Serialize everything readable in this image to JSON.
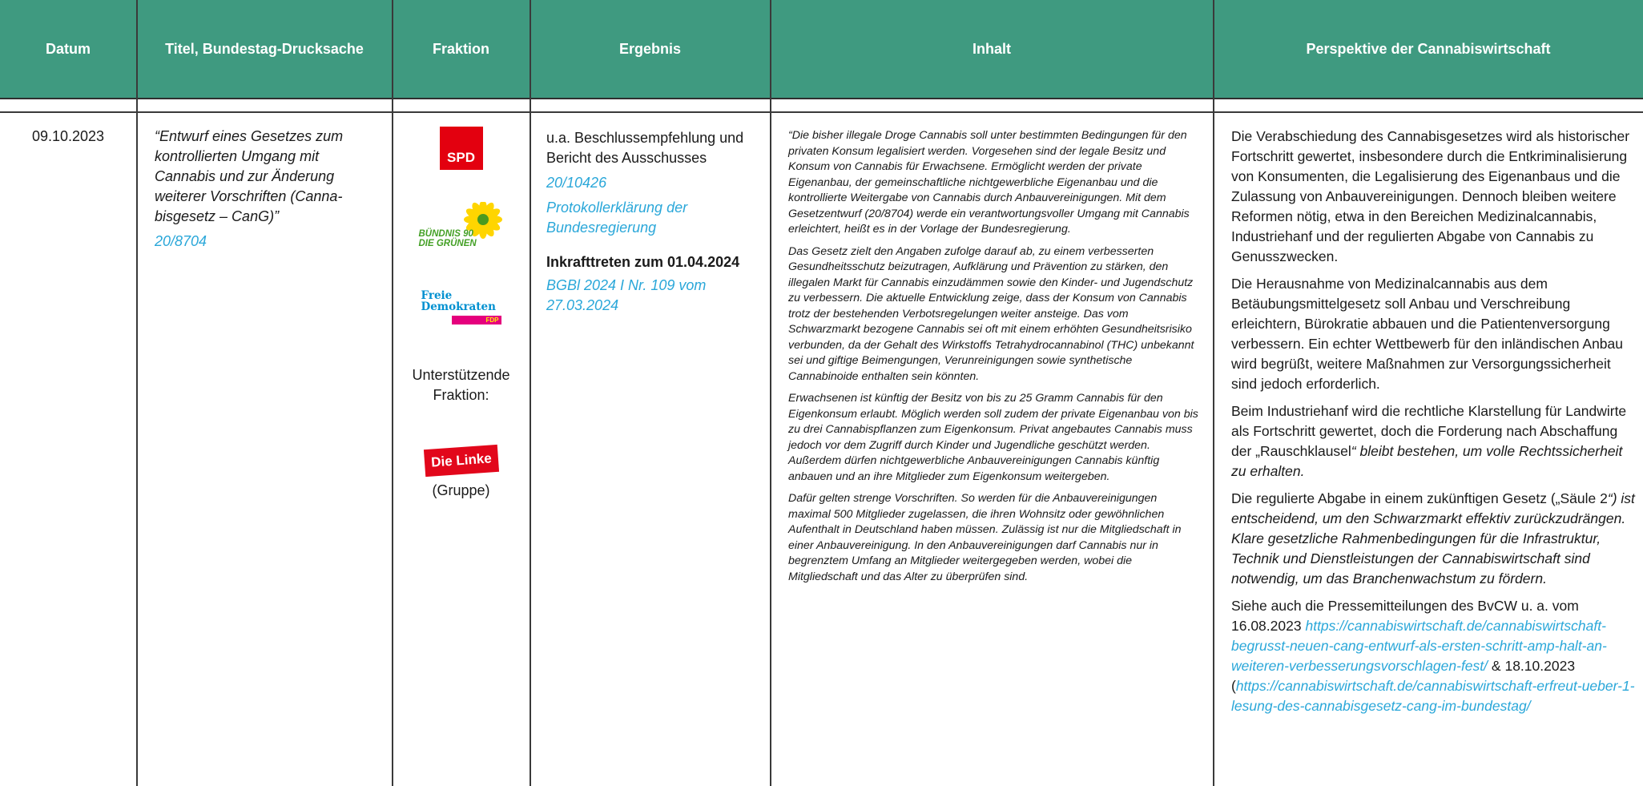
{
  "header": {
    "datum": "Datum",
    "titel": "Titel, Bundestag-Drucksache",
    "fraktion": "Fraktion",
    "ergebnis": "Ergebnis",
    "inhalt": "Inhalt",
    "perspektive": "Perspektive der Cannabiswirtschaft"
  },
  "row": {
    "datum": "09.10.2023",
    "titel": "“Entwurf eines Gesetzes zum kontrollierten Umgang mit Cannabis und zur Änderung weiterer Vorschriften (Canna­bisgesetz – CanG)”",
    "drucksache": "20/8704",
    "fraktion": {
      "spd": "SPD",
      "gruene_line1": "BÜNDNIS 90",
      "gruene_line2": "DIE GRÜNEN",
      "fdp_line1": "Freie",
      "fdp_line2": "Demokraten",
      "fdp_bar": "FDP",
      "unterstuetzend": "Unterstützende Fraktion:",
      "linke": "Die Linke",
      "gruppe": "(Gruppe)"
    },
    "ergebnis": {
      "text": "u.a. Beschlussempfehlung und Bericht des Ausschusses",
      "link1": "20/10426",
      "link2": "Protokollerklärung der Bundesregierung",
      "inkraft": "Inkrafttreten zum 01.04.2024",
      "bgbl": "BGBl 2024 I Nr. 109 vom 27.03.2024"
    },
    "inhalt": {
      "p1": "“Die bisher illegale Droge Cannabis soll unter bestimmten Be­dingungen für den privaten Konsum legalisiert werden. Vorgesehen sind der legale Besitz und Konsum von Cannabis für Erwachsene. Ermöglicht werden der private Eigenanbau, der gemeinschaftliche nichtgewerbliche Eigenanbau und die kontrollierte Weitergabe von Cannabis durch Anbauvereinigungen. Mit dem Gesetzentwurf (20/8704) werde ein verantwortungsvoller Umgang mit Cannabis erleichtert, heißt es in der Vorlage der Bundesregierung.",
      "p2": "Das Gesetz zielt den Angaben zufolge darauf ab, zu einem verbes­serten Gesundheitsschutz beizutragen, Aufklärung und Prävention zu stärken, den illegalen Markt für Cannabis einzudämmen sowie den Kinder- und Jugendschutz zu verbessern. Die aktuelle Entwick­lung zeige, dass der Konsum von Cannabis trotz der bestehenden Verbotsregelungen weiter ansteige. Das vom Schwarzmarkt bezogene Cannabis sei oft mit einem erhöhten Gesundheitsrisiko verbunden, da der Gehalt des Wirkstoffs Tetrahydrocannabinol (THC) unbekannt sei und giftige Beimengungen, Verunreinigungen sowie synthetische Cannabinoide enthalten sein könnten.",
      "p3": "Erwachsenen ist künftig der Besitz von bis zu 25 Gramm Cannabis für den Eigenkonsum erlaubt. Möglich werden soll zudem der private Eigenanbau von bis zu drei Cannabispflanzen zum Eigen­konsum. Privat angebautes Cannabis muss jedoch vor dem Zugriff durch Kinder und Jugendliche geschützt werden. Außerdem dürfen nichtgewerbliche Anbauvereinigungen Cannabis künftig anbauen und an ihre Mitglieder zum Eigenkonsum weitergeben.",
      "p4": "Dafür gelten strenge Vorschriften. So werden für die Anbauver­einigungen maximal 500 Mitglieder zugelassen, die ihren Wohnsitz oder gewöhnlichen Aufenthalt in Deutschland haben müssen. Zulässig ist nur die Mitgliedschaft in einer Anbauvereinigung. In den Anbauvereinigungen darf Cannabis nur in begrenztem Umfang an Mitglieder weitergegeben werden, wobei die Mitgliedschaft und das Alter zu überprüfen sind."
    },
    "perspektive": {
      "p1": "Die Verabschiedung des Cannabisgesetzes wird als historischer Fortschritt gewertet, insbesondere durch die Entkriminalisierung von Konsumenten, die Legalisierung des Eigenanbaus und die Zulassung von Anbauvereinigun­gen. Dennoch bleiben weitere Reformen nötig, etwa in den Bereichen Medizinalcannabis, Industriehanf und der regulierten Abgabe von Cannabis zu Genusszwecken.",
      "p2": "Die Herausnahme von Medizinalcannabis aus dem Betäubungsmittelgesetz soll Anbau und Verschreibung erleichtern, Bürokratie abbauen und die Patientenver­sorgung verbessern. Ein echter Wettbewerb für den inländischen Anbau wird begrüßt, weitere Maßnahmen zur Versorgungssicherheit sind jedoch erforderlich.",
      "p3_plain": "Beim Industriehanf wird die rechtliche Klarstellung für Landwirte als Fortschritt gewertet, doch die Forderung nach Abschaffung der „Rauschklausel",
      "p3_ital": "“ bleibt bestehen, um volle Rechtssicherheit zu erhalten.",
      "p4_plain": "Die regulierte Abgabe in einem zukünftigen Gesetz („Säule 2",
      "p4_ital": "“) ist entscheidend, um den Schwarzmarkt effektiv zurückzudrängen. Klare gesetzliche Rahmenbedingungen für die Infrastruktur, Technik und Dienstleistungen der Cannabiswirtschaft sind notwendig, um das Branchen­wachstum zu fördern.",
      "p5_intro": "Siehe auch die Pressemitteilungen des BvCW u. a. vom 16.08.2023",
      "p5_link1": "https://cannabiswirtschaft.de/cannabiswirt­schaft-begrusst-neuen-cang-entwurf-als-ersten-schritt-amp-halt-an-weiteren-verbesserungsvorschlagen-fest/",
      "p5_amp": "&",
      "p5_date2": "18.10.2023 (",
      "p5_link2": "https://cannabiswirtschaft.de/cannabiswirt­schaft-erfreut-ueber-1-lesung-des-cannabisgesetz-cang-im-bundestag/"
    }
  },
  "colors": {
    "header_bg": "#3f9a80",
    "link": "#2aa7d9"
  }
}
